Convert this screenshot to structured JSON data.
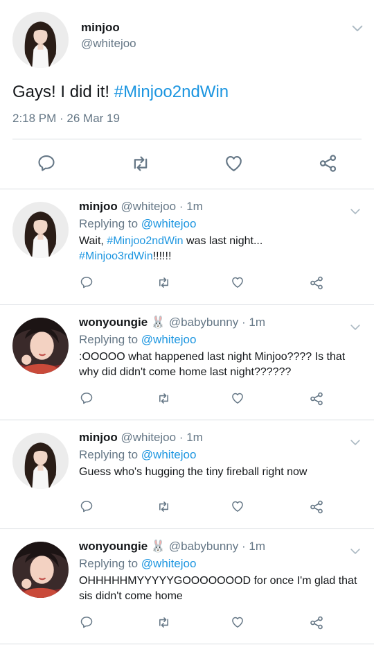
{
  "colors": {
    "link": "#1b95e0",
    "muted": "#657786",
    "icon": "#657786",
    "divider": "#d9dde1"
  },
  "main_tweet": {
    "name": "minjoo",
    "handle": "@whitejoo",
    "text": "Gays! I did it! ",
    "hashtag": "#Minjoo2ndWin",
    "timestamp": "2:18 PM · 26 Mar 19",
    "icons": [
      "reply-icon",
      "retweet-icon",
      "like-icon",
      "share-icon",
      "chevron-down-icon"
    ]
  },
  "replies": [
    {
      "name": "minjoo",
      "handle": "@whitejoo",
      "time": "· 1m",
      "replying_prefix": "Replying to",
      "replying_to": "@whitejoo",
      "body_1": "Wait, ",
      "hashtag_1": "#Minjoo2ndWin",
      "body_2": " was last night...",
      "hashtag_2": "#Minjoo3rdWin",
      "body_3": "!!!!!!"
    },
    {
      "name": "wonyoungie",
      "emoji": "🐰",
      "handle": "@babybunny",
      "time": "· 1m",
      "replying_prefix": "Replying to",
      "replying_to": "@whitejoo",
      "body": ":OOOOO what happened last night Minjoo???? Is that why did didn't come home last night??????"
    },
    {
      "name": "minjoo",
      "handle": "@whitejoo",
      "time": "· 1m",
      "replying_prefix": "Replying to",
      "replying_to": "@whitejoo",
      "body": "Guess who's hugging the tiny fireball right now"
    },
    {
      "name": "wonyoungie",
      "emoji": "🐰",
      "handle": "@babybunny",
      "time": "· 1m",
      "replying_prefix": "Replying to",
      "replying_to": "@whitejoo",
      "body": "OHHHHHMYYYYYGOOOOOOOD for once I'm glad that sis didn't come home"
    }
  ]
}
